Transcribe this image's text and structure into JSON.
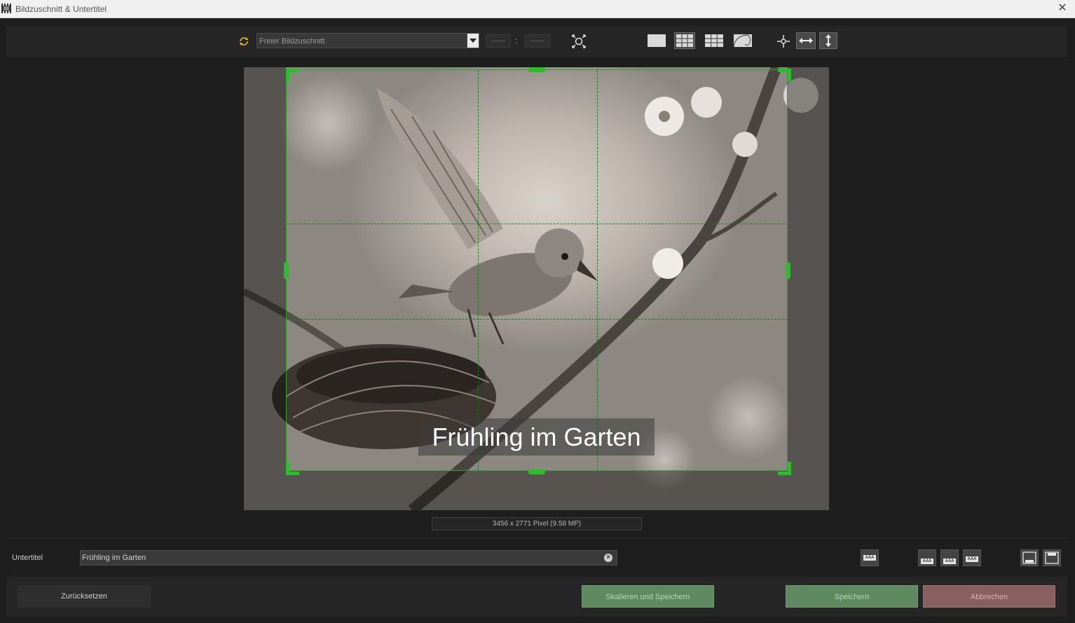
{
  "window": {
    "title": "Bildzuschnitt & Untertitel"
  },
  "toolbar": {
    "preset_selected": "Freier Bildzuschnitt",
    "ratio_width_placeholder": "——",
    "ratio_height_placeholder": "——",
    "ratio_separator": ":",
    "grid_mode_active": "thirds-grid"
  },
  "canvas": {
    "caption_overlay": "Frühling im Garten",
    "crop_guide": "rule-of-thirds",
    "accent_color": "#27c127"
  },
  "image_info": "3456 x 2771  Pixel  (9.58 MP)",
  "subtitle": {
    "label": "Untertitel",
    "value": "Frühling im Garten",
    "clear_icon": "clear-icon"
  },
  "caption_position_buttons": [
    "caption-style-icon",
    "caption-left-icon",
    "caption-center-icon",
    "caption-right-icon",
    "caption-bottom-icon",
    "caption-top-icon"
  ],
  "actions": {
    "reset": "Zurücksetzen",
    "scale_save": "Skalieren und Speichern",
    "save": "Speichern",
    "cancel": "Abbrechen"
  },
  "colors": {
    "save_button": "#5f8a5f",
    "cancel_button": "#8a5f5f",
    "background": "#1e1e1e"
  }
}
